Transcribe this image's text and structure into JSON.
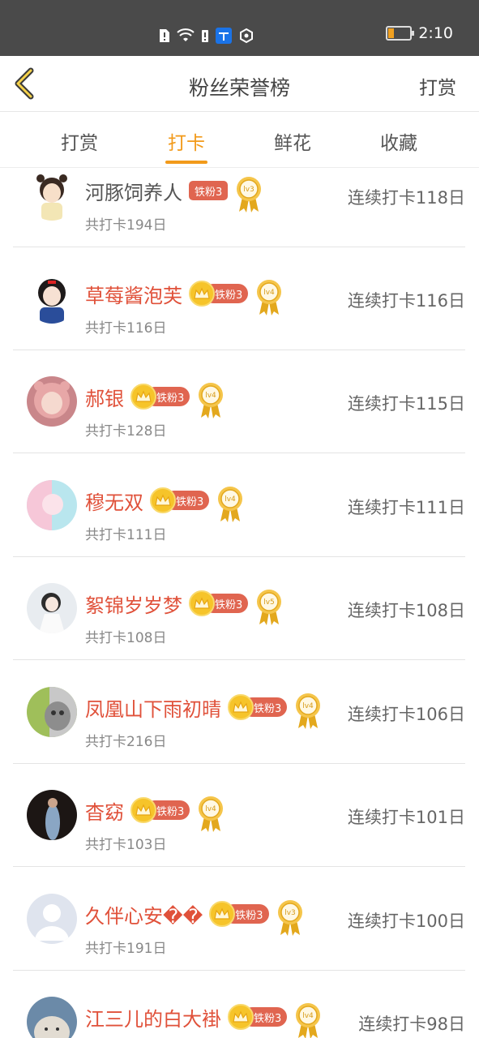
{
  "status": {
    "time": "2:10"
  },
  "nav": {
    "title": "粉丝荣誉榜",
    "right": "打赏"
  },
  "tabs": [
    {
      "label": "打赏"
    },
    {
      "label": "打卡"
    },
    {
      "label": "鲜花"
    },
    {
      "label": "收藏"
    }
  ],
  "active_tab": "打卡",
  "colors": {
    "accent": "#f29a1a",
    "name_red": "#e0513a",
    "badge_red": "#e06550",
    "crown_gold": "#f6c42a"
  },
  "rows": [
    {
      "name": "河豚饲养人",
      "badge": "铁粉3",
      "level": "lv3",
      "total": "共打卡194日",
      "streak": "连续打卡118日",
      "crown": false,
      "plain": true,
      "avatar": "cartoon-girl"
    },
    {
      "name": "草莓酱泡芙",
      "badge": "铁粉3",
      "level": "lv4",
      "total": "共打卡116日",
      "streak": "连续打卡116日",
      "crown": true,
      "avatar": "cartoon-princess"
    },
    {
      "name": "郝银",
      "badge": "铁粉3",
      "level": "lv4",
      "total": "共打卡128日",
      "streak": "连续打卡115日",
      "crown": true,
      "avatar": "pink-hood"
    },
    {
      "name": "穆无双",
      "badge": "铁粉3",
      "level": "lv4",
      "total": "共打卡111日",
      "streak": "连续打卡111日",
      "crown": true,
      "avatar": "pastel"
    },
    {
      "name": "絮锦岁岁梦",
      "badge": "铁粉3",
      "level": "lv5",
      "total": "共打卡108日",
      "streak": "连续打卡108日",
      "crown": true,
      "avatar": "white-dress"
    },
    {
      "name": "凤凰山下雨初晴",
      "badge": "铁粉3",
      "level": "lv4",
      "total": "共打卡216日",
      "streak": "连续打卡106日",
      "crown": true,
      "avatar": "cat"
    },
    {
      "name": "杳窈",
      "badge": "铁粉3",
      "level": "lv4",
      "total": "共打卡103日",
      "streak": "连续打卡101日",
      "crown": true,
      "avatar": "dark-figure"
    },
    {
      "name": "久伴心安��",
      "badge": "铁粉3",
      "level": "lv3",
      "total": "共打卡191日",
      "streak": "连续打卡100日",
      "crown": true,
      "avatar": "default"
    },
    {
      "name": "江三儿的白大褂",
      "badge": "铁粉3",
      "level": "lv4",
      "total": "",
      "streak": "连续打卡98日",
      "crown": true,
      "avatar": "animal"
    }
  ]
}
